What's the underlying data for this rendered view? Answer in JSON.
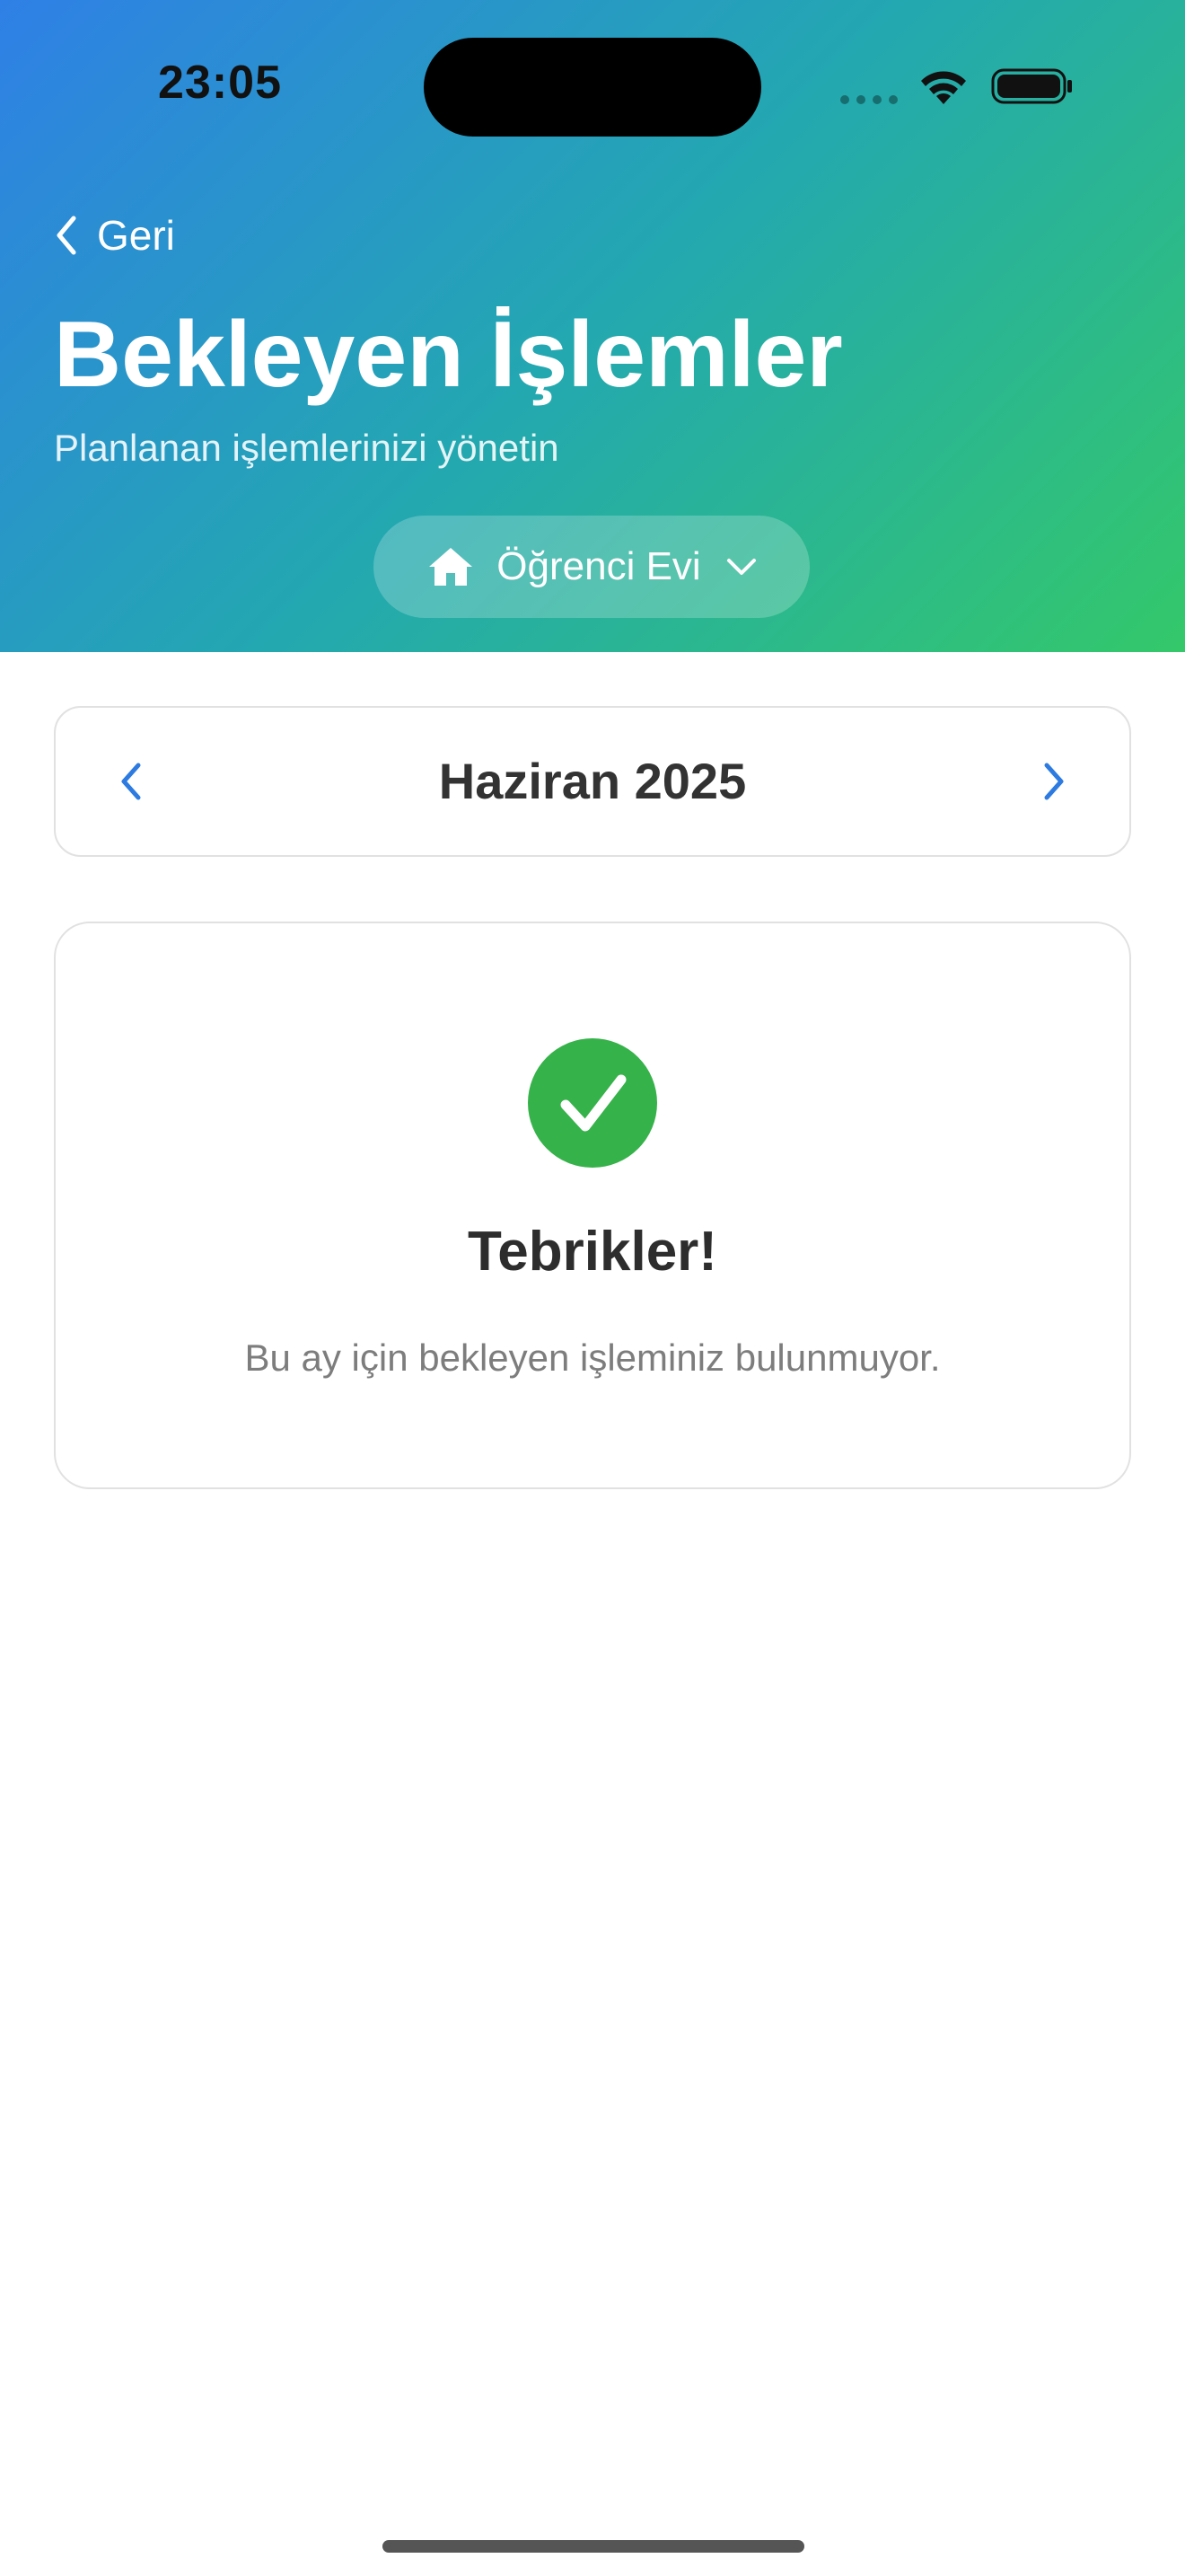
{
  "status_bar": {
    "time": "23:05",
    "wifi_icon": "wifi-icon",
    "battery_icon": "battery-icon",
    "signal_icon": "cellular-signal-icon"
  },
  "header": {
    "back_label": "Geri",
    "title": "Bekleyen İşlemler",
    "subtitle": "Planlanan işlemlerinizi yönetin",
    "home_selector": {
      "label": "Öğrenci Evi",
      "icon": "house-icon",
      "dropdown_icon": "chevron-down-icon"
    },
    "gradient": [
      "#2f80e6",
      "#23a8b0",
      "#34c86a"
    ]
  },
  "month_nav": {
    "month_label": "Haziran 2025",
    "prev_icon": "chevron-left-icon",
    "next_icon": "chevron-right-icon",
    "accent": "#2d7be0"
  },
  "empty_state": {
    "icon": "checkmark-circle-icon",
    "icon_color": "#36b24a",
    "title": "Tebrikler!",
    "message": "Bu ay için bekleyen işleminiz bulunmuyor."
  }
}
